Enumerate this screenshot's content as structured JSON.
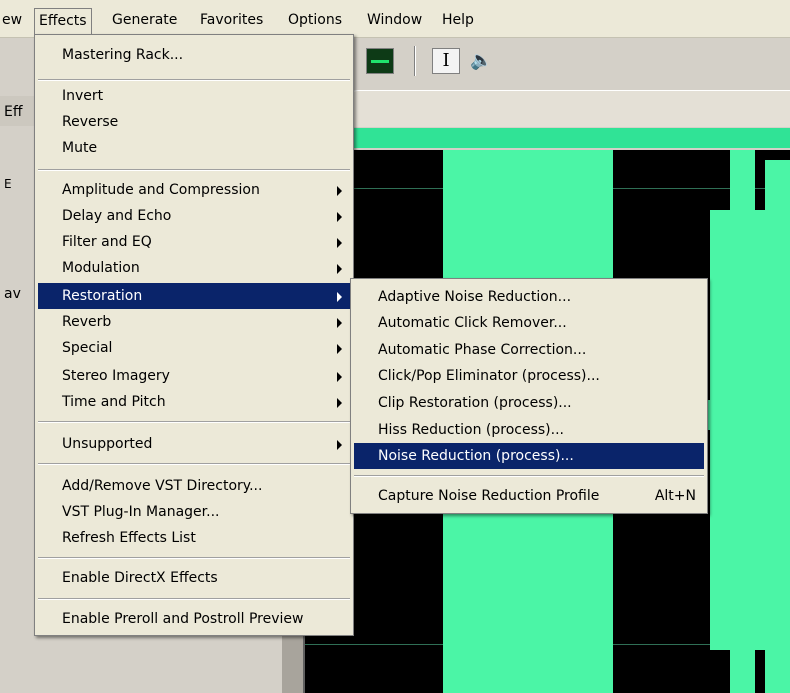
{
  "menubar": {
    "items": [
      {
        "label": "ew"
      },
      {
        "label": "Effects"
      },
      {
        "label": "Generate"
      },
      {
        "label": "Favorites"
      },
      {
        "label": "Options"
      },
      {
        "label": "Window"
      },
      {
        "label": "Help"
      }
    ]
  },
  "toolbar": {
    "icons": [
      "waveform-view-icon",
      "ibeam-cursor-icon",
      "speaker-icon"
    ],
    "ibeam_glyph": "I",
    "speaker_glyph": "🔈"
  },
  "left_panel": {
    "tab_label": "Eff",
    "icon_glyph": "E",
    "file_text": "av"
  },
  "colors": {
    "menu_bg": "#ece9d8",
    "highlight": "#0a246a",
    "waveform": "#4bf5a6",
    "waveform_bg": "#000000"
  },
  "effects_menu": {
    "items": [
      {
        "label": "Mastering Rack..."
      },
      {
        "label": "Invert"
      },
      {
        "label": "Reverse"
      },
      {
        "label": "Mute"
      },
      {
        "label": "Amplitude and Compression",
        "submenu": true
      },
      {
        "label": "Delay and Echo",
        "submenu": true
      },
      {
        "label": "Filter and EQ",
        "submenu": true
      },
      {
        "label": "Modulation",
        "submenu": true
      },
      {
        "label": "Restoration",
        "submenu": true,
        "highlighted": true
      },
      {
        "label": "Reverb",
        "submenu": true
      },
      {
        "label": "Special",
        "submenu": true
      },
      {
        "label": "Stereo Imagery",
        "submenu": true
      },
      {
        "label": "Time and Pitch",
        "submenu": true
      },
      {
        "label": "Unsupported",
        "submenu": true
      },
      {
        "label": "Add/Remove VST Directory..."
      },
      {
        "label": "VST Plug-In Manager..."
      },
      {
        "label": "Refresh Effects List"
      },
      {
        "label": "Enable DirectX Effects"
      },
      {
        "label": "Enable Preroll and Postroll Preview"
      }
    ]
  },
  "restoration_submenu": {
    "items": [
      {
        "label": "Adaptive Noise Reduction..."
      },
      {
        "label": "Automatic Click Remover..."
      },
      {
        "label": "Automatic Phase Correction..."
      },
      {
        "label": "Click/Pop Eliminator (process)..."
      },
      {
        "label": "Clip Restoration (process)..."
      },
      {
        "label": "Hiss Reduction (process)..."
      },
      {
        "label": "Noise Reduction (process)...",
        "highlighted": true
      },
      {
        "label": "Capture Noise Reduction Profile",
        "shortcut": "Alt+N"
      }
    ]
  }
}
